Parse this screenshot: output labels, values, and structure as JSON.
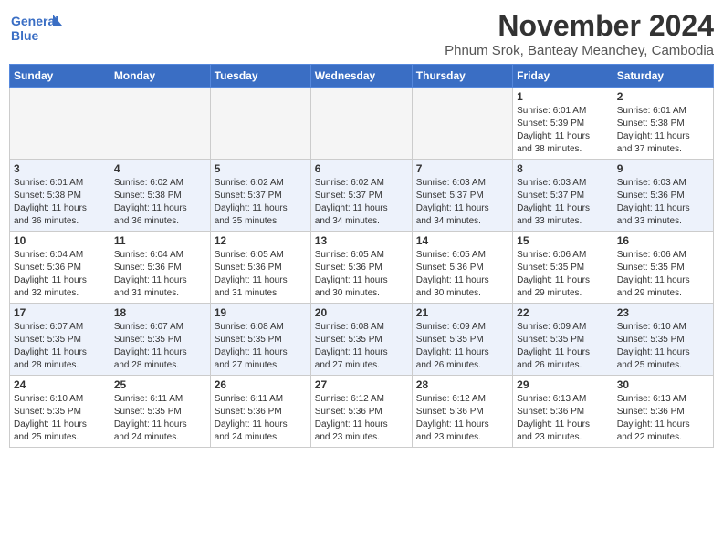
{
  "header": {
    "logo_line1": "General",
    "logo_line2": "Blue",
    "month": "November 2024",
    "location": "Phnum Srok, Banteay Meanchey, Cambodia"
  },
  "weekdays": [
    "Sunday",
    "Monday",
    "Tuesday",
    "Wednesday",
    "Thursday",
    "Friday",
    "Saturday"
  ],
  "weeks": [
    [
      {
        "day": "",
        "info": ""
      },
      {
        "day": "",
        "info": ""
      },
      {
        "day": "",
        "info": ""
      },
      {
        "day": "",
        "info": ""
      },
      {
        "day": "",
        "info": ""
      },
      {
        "day": "1",
        "info": "Sunrise: 6:01 AM\nSunset: 5:39 PM\nDaylight: 11 hours\nand 38 minutes."
      },
      {
        "day": "2",
        "info": "Sunrise: 6:01 AM\nSunset: 5:38 PM\nDaylight: 11 hours\nand 37 minutes."
      }
    ],
    [
      {
        "day": "3",
        "info": "Sunrise: 6:01 AM\nSunset: 5:38 PM\nDaylight: 11 hours\nand 36 minutes."
      },
      {
        "day": "4",
        "info": "Sunrise: 6:02 AM\nSunset: 5:38 PM\nDaylight: 11 hours\nand 36 minutes."
      },
      {
        "day": "5",
        "info": "Sunrise: 6:02 AM\nSunset: 5:37 PM\nDaylight: 11 hours\nand 35 minutes."
      },
      {
        "day": "6",
        "info": "Sunrise: 6:02 AM\nSunset: 5:37 PM\nDaylight: 11 hours\nand 34 minutes."
      },
      {
        "day": "7",
        "info": "Sunrise: 6:03 AM\nSunset: 5:37 PM\nDaylight: 11 hours\nand 34 minutes."
      },
      {
        "day": "8",
        "info": "Sunrise: 6:03 AM\nSunset: 5:37 PM\nDaylight: 11 hours\nand 33 minutes."
      },
      {
        "day": "9",
        "info": "Sunrise: 6:03 AM\nSunset: 5:36 PM\nDaylight: 11 hours\nand 33 minutes."
      }
    ],
    [
      {
        "day": "10",
        "info": "Sunrise: 6:04 AM\nSunset: 5:36 PM\nDaylight: 11 hours\nand 32 minutes."
      },
      {
        "day": "11",
        "info": "Sunrise: 6:04 AM\nSunset: 5:36 PM\nDaylight: 11 hours\nand 31 minutes."
      },
      {
        "day": "12",
        "info": "Sunrise: 6:05 AM\nSunset: 5:36 PM\nDaylight: 11 hours\nand 31 minutes."
      },
      {
        "day": "13",
        "info": "Sunrise: 6:05 AM\nSunset: 5:36 PM\nDaylight: 11 hours\nand 30 minutes."
      },
      {
        "day": "14",
        "info": "Sunrise: 6:05 AM\nSunset: 5:36 PM\nDaylight: 11 hours\nand 30 minutes."
      },
      {
        "day": "15",
        "info": "Sunrise: 6:06 AM\nSunset: 5:35 PM\nDaylight: 11 hours\nand 29 minutes."
      },
      {
        "day": "16",
        "info": "Sunrise: 6:06 AM\nSunset: 5:35 PM\nDaylight: 11 hours\nand 29 minutes."
      }
    ],
    [
      {
        "day": "17",
        "info": "Sunrise: 6:07 AM\nSunset: 5:35 PM\nDaylight: 11 hours\nand 28 minutes."
      },
      {
        "day": "18",
        "info": "Sunrise: 6:07 AM\nSunset: 5:35 PM\nDaylight: 11 hours\nand 28 minutes."
      },
      {
        "day": "19",
        "info": "Sunrise: 6:08 AM\nSunset: 5:35 PM\nDaylight: 11 hours\nand 27 minutes."
      },
      {
        "day": "20",
        "info": "Sunrise: 6:08 AM\nSunset: 5:35 PM\nDaylight: 11 hours\nand 27 minutes."
      },
      {
        "day": "21",
        "info": "Sunrise: 6:09 AM\nSunset: 5:35 PM\nDaylight: 11 hours\nand 26 minutes."
      },
      {
        "day": "22",
        "info": "Sunrise: 6:09 AM\nSunset: 5:35 PM\nDaylight: 11 hours\nand 26 minutes."
      },
      {
        "day": "23",
        "info": "Sunrise: 6:10 AM\nSunset: 5:35 PM\nDaylight: 11 hours\nand 25 minutes."
      }
    ],
    [
      {
        "day": "24",
        "info": "Sunrise: 6:10 AM\nSunset: 5:35 PM\nDaylight: 11 hours\nand 25 minutes."
      },
      {
        "day": "25",
        "info": "Sunrise: 6:11 AM\nSunset: 5:35 PM\nDaylight: 11 hours\nand 24 minutes."
      },
      {
        "day": "26",
        "info": "Sunrise: 6:11 AM\nSunset: 5:36 PM\nDaylight: 11 hours\nand 24 minutes."
      },
      {
        "day": "27",
        "info": "Sunrise: 6:12 AM\nSunset: 5:36 PM\nDaylight: 11 hours\nand 23 minutes."
      },
      {
        "day": "28",
        "info": "Sunrise: 6:12 AM\nSunset: 5:36 PM\nDaylight: 11 hours\nand 23 minutes."
      },
      {
        "day": "29",
        "info": "Sunrise: 6:13 AM\nSunset: 5:36 PM\nDaylight: 11 hours\nand 23 minutes."
      },
      {
        "day": "30",
        "info": "Sunrise: 6:13 AM\nSunset: 5:36 PM\nDaylight: 11 hours\nand 22 minutes."
      }
    ]
  ]
}
